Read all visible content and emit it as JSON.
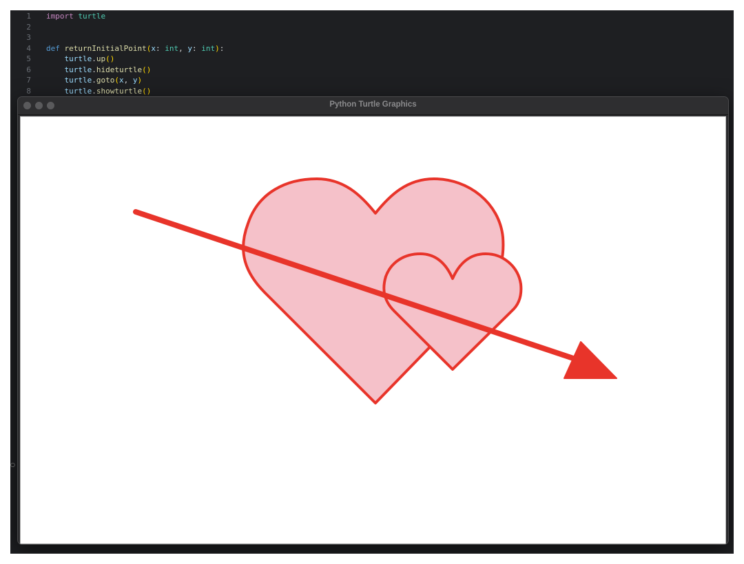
{
  "editor": {
    "lines": [
      {
        "num": "1",
        "tokens": [
          [
            "kw",
            "import"
          ],
          [
            "punc",
            " "
          ],
          [
            "mod",
            "turtle"
          ]
        ]
      },
      {
        "num": "2",
        "tokens": []
      },
      {
        "num": "3",
        "tokens": []
      },
      {
        "num": "4",
        "tokens": [
          [
            "kwdef",
            "def"
          ],
          [
            "punc",
            " "
          ],
          [
            "fn",
            "returnInitialPoint"
          ],
          [
            "paren",
            "("
          ],
          [
            "obj",
            "x"
          ],
          [
            "punc",
            ": "
          ],
          [
            "ty",
            "int"
          ],
          [
            "punc",
            ", "
          ],
          [
            "obj",
            "y"
          ],
          [
            "punc",
            ": "
          ],
          [
            "ty",
            "int"
          ],
          [
            "paren",
            ")"
          ],
          [
            "punc",
            ":"
          ]
        ]
      },
      {
        "num": "5",
        "tokens": [
          [
            "punc",
            "    "
          ],
          [
            "obj",
            "turtle"
          ],
          [
            "punc",
            "."
          ],
          [
            "fn",
            "up"
          ],
          [
            "paren",
            "()"
          ]
        ]
      },
      {
        "num": "6",
        "tokens": [
          [
            "punc",
            "    "
          ],
          [
            "obj",
            "turtle"
          ],
          [
            "punc",
            "."
          ],
          [
            "fn",
            "hideturtle"
          ],
          [
            "paren",
            "()"
          ]
        ]
      },
      {
        "num": "7",
        "tokens": [
          [
            "punc",
            "    "
          ],
          [
            "obj",
            "turtle"
          ],
          [
            "punc",
            "."
          ],
          [
            "fn",
            "goto"
          ],
          [
            "paren",
            "("
          ],
          [
            "obj",
            "x"
          ],
          [
            "punc",
            ", "
          ],
          [
            "obj",
            "y"
          ],
          [
            "paren",
            ")"
          ]
        ]
      },
      {
        "num": "8",
        "tokens": [
          [
            "punc",
            "    "
          ],
          [
            "obj",
            "turtle"
          ],
          [
            "punc",
            "."
          ],
          [
            "fn",
            "showturtle"
          ],
          [
            "paren",
            "()"
          ]
        ]
      }
    ]
  },
  "window": {
    "title": "Python Turtle Graphics"
  },
  "drawing": {
    "heart_fill": "#f5c1c9",
    "stroke_color": "#e8342a",
    "arrow_color": "#e8342a"
  }
}
